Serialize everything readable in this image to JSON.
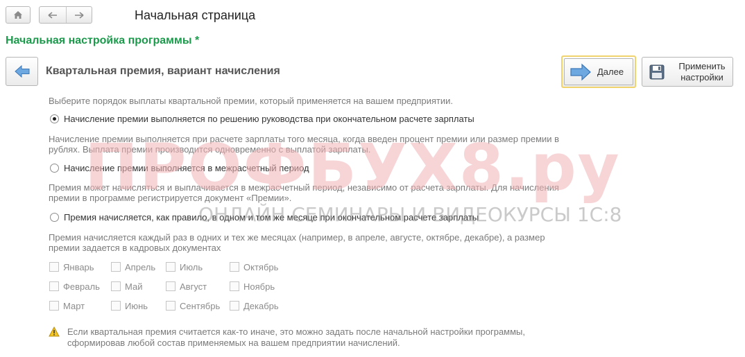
{
  "nav": {
    "page_title": "Начальная страница"
  },
  "setup_title": "Начальная настройка программы *",
  "section_title": "Квартальная премия,  вариант начисления",
  "buttons": {
    "next_label": "Далее",
    "apply_label_line1": "Применить",
    "apply_label_line2": "настройки"
  },
  "intro": "Выберите порядок выплаты квартальной премии, который применяется на вашем предприятии.",
  "options": [
    {
      "label": "Начисление премии выполняется по решению руководства при окончательном расчете зарплаты",
      "selected": true,
      "desc_line1": "Начисление премии выполняется при расчете зарплаты того месяца, когда введен процент премии или размер премии в",
      "desc_line2": "рублях. Выплата премии производится одновременно с выплатой зарплаты."
    },
    {
      "label": "Начисление премии выполняется в межрасчетный период",
      "selected": false,
      "desc_line1": "Премия может начисляться и выплачивается в межрасчетный период, независимо от расчета зарплаты. Для начисления",
      "desc_line2": "премии в программе регистрируется документ «Премии»."
    },
    {
      "label": "Премия начисляется, как правило, в одном и том же месяце при окончательном расчете зарплаты",
      "selected": false,
      "desc_line1": "Премия начисляется каждый раз в одних и тех же месяцах (например, в апреле, августе, октябре, декабре), а размер",
      "desc_line2": "премии задается в кадровых документах"
    }
  ],
  "months": [
    [
      "Январь",
      "Апрель",
      "Июль",
      "Октябрь"
    ],
    [
      "Февраль",
      "Май",
      "Август",
      "Ноябрь"
    ],
    [
      "Март",
      "Июнь",
      "Сентябрь",
      "Декабрь"
    ]
  ],
  "warning_line1": "Если квартальная премия считается как-то иначе, это можно задать после начальной настройки программы,",
  "warning_line2": "сформировав любой состав применяемых на вашем предприятии начислений.",
  "watermark": {
    "main": "ПРОФБУХ8.ру",
    "sub": "ОНЛАЙН СЕМИНАРЫ И ВИДЕОКУРСЫ 1С:8"
  },
  "colors": {
    "title_green": "#1b9a4b",
    "next_border": "#f0d36c",
    "arrow_blue": "#5b9bd5"
  },
  "icons": [
    "home-icon",
    "arrow-left-icon",
    "arrow-right-icon",
    "back-arrow-icon",
    "next-arrow-icon",
    "save-disk-icon",
    "warning-icon"
  ]
}
